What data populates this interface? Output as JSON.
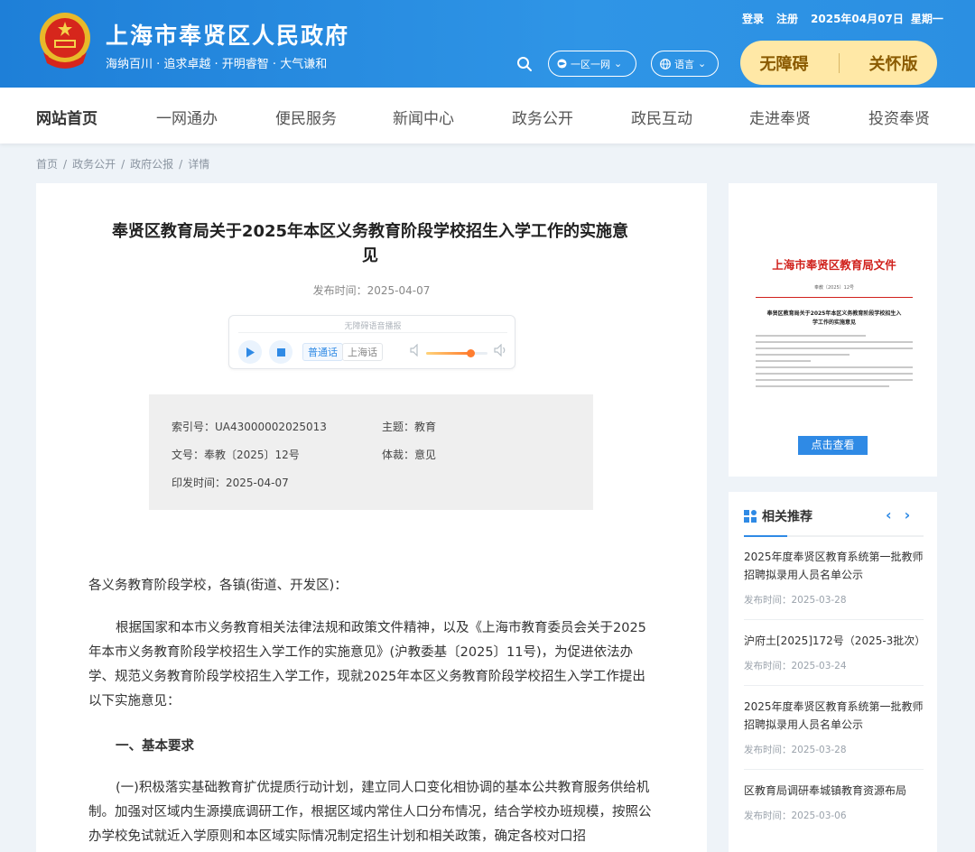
{
  "header": {
    "site_title": "上海市奉贤区人民政府",
    "slogan": "海纳百川 · 追求卓越 · 开明睿智 · 大气谦和",
    "login": "登录",
    "register": "注册",
    "date": "2025年04月07日",
    "weekday": "星期一",
    "yiqu_label": "一区一网",
    "lang_label": "语言",
    "accessible_label": "无障碍",
    "care_label": "关怀版"
  },
  "nav": {
    "items": [
      "网站首页",
      "一网通办",
      "便民服务",
      "新闻中心",
      "政务公开",
      "政民互动",
      "走进奉贤",
      "投资奉贤"
    ],
    "active": "网站首页"
  },
  "breadcrumb": [
    "首页",
    "政务公开",
    "政府公报",
    "详情"
  ],
  "article": {
    "title": "奉贤区教育局关于2025年本区义务教育阶段学校招生入学工作的实施意见",
    "publish_time": "发布时间：2025-04-07",
    "player": {
      "caption": "无障碍语音播报",
      "dialect_1": "普通话",
      "dialect_2": "上海话",
      "volume_level": 0.72
    },
    "meta": {
      "index_no": "索引号：UA43000002025013",
      "topic": "主题：教育",
      "doc_no": "文号：奉教〔2025〕12号",
      "genre": "体裁：意见",
      "issue_date": "印发时间：2025-04-07"
    },
    "para0": "各义务教育阶段学校，各镇(街道、开发区)：",
    "para1": "根据国家和本市义务教育相关法律法规和政策文件精神，以及《上海市教育委员会关于2025年本市义务教育阶段学校招生入学工作的实施意见》(沪教委基〔2025〕11号)，为促进依法办学、规范义务教育阶段学校招生入学工作，现就2025年本区义务教育阶段学校招生入学工作提出以下实施意见：",
    "heading1": "一、基本要求",
    "para2": "(一)积极落实基础教育扩优提质行动计划，建立同人口变化相协调的基本公共教育服务供给机制。加强对区域内生源摸底调研工作，根据区域内常住人口分布情况，结合学校办班规模，按照公办学校免试就近入学原则和本区域实际情况制定招生计划和相关政策，确定各校对口招"
  },
  "preview": {
    "paper_header": "上海市奉贤区教育局文件",
    "paper_no": "奉教〔2025〕12号",
    "paper_title": "奉贤区教育局关于2025年本区义务教育阶段学校招生入学工作的实施意见",
    "view_button": "点击查看"
  },
  "related": {
    "title": "相关推荐",
    "items": [
      {
        "title": "2025年度奉贤区教育系统第一批教师招聘拟录用人员名单公示",
        "date": "发布时间：2025-03-28"
      },
      {
        "title": "沪府土[2025]172号（2025-3批次）",
        "date": "发布时间：2025-03-24"
      },
      {
        "title": "2025年度奉贤区教育系统第一批教师招聘拟录用人员名单公示",
        "date": "发布时间：2025-03-28"
      },
      {
        "title": "区教育局调研奉城镇教育资源布局",
        "date": "发布时间：2025-03-06"
      }
    ]
  },
  "colors": {
    "header_blue": "#2b8fe2",
    "accent_blue": "#2f8ae5",
    "access_yellow": "#ffe8a6",
    "doc_red": "#d0211c"
  }
}
